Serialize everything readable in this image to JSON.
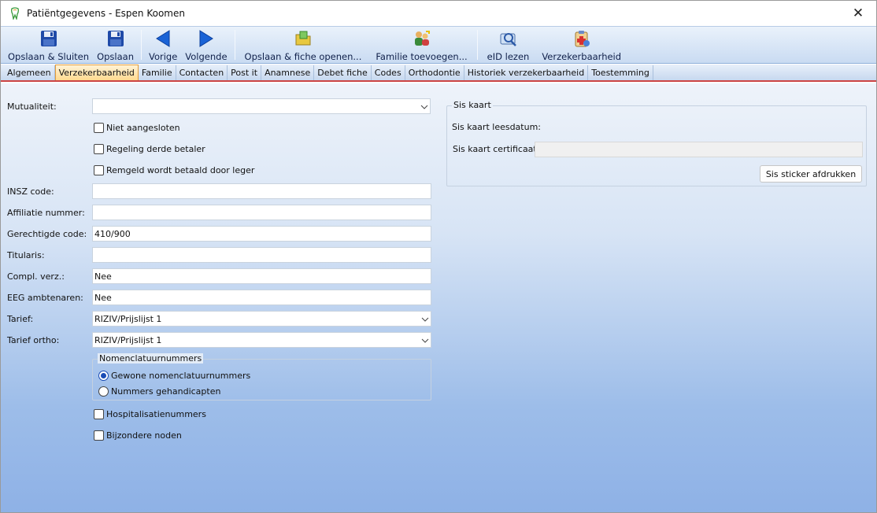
{
  "window": {
    "title": "Patiëntgegevens - Espen Koomen"
  },
  "toolbar": {
    "save_close": "Opslaan & Sluiten",
    "save": "Opslaan",
    "previous": "Vorige",
    "next": "Volgende",
    "save_open_fiche": "Opslaan & fiche openen...",
    "add_family": "Familie toevoegen...",
    "read_eid": "eID lezen",
    "insurability": "Verzekerbaarheid"
  },
  "tabs": [
    "Algemeen",
    "Verzekerbaarheid",
    "Familie",
    "Contacten",
    "Post it",
    "Anamnese",
    "Debet fiche",
    "Codes",
    "Orthodontie",
    "Historiek verzekerbaarheid",
    "Toestemming"
  ],
  "form": {
    "mutualiteit_label": "Mutualiteit:",
    "mutualiteit_value": "",
    "niet_aangesloten": "Niet aangesloten",
    "derde_betaler": "Regeling derde betaler",
    "remgeld_leger": "Remgeld wordt betaald door leger",
    "insz_label": "INSZ code:",
    "insz_value": "",
    "affiliatie_label": "Affiliatie nummer:",
    "affiliatie_value": "",
    "gerechtigde_label": "Gerechtigde code:",
    "gerechtigde_value": "410/900",
    "titularis_label": "Titularis:",
    "titularis_value": "",
    "compl_label": "Compl. verz.:",
    "compl_value": "Nee",
    "eeg_label": "EEG ambtenaren:",
    "eeg_value": "Nee",
    "tarief_label": "Tarief:",
    "tarief_value": "RIZIV/Prijslijst 1",
    "tarief_ortho_label": "Tarief ortho:",
    "tarief_ortho_value": "RIZIV/Prijslijst 1",
    "nomenclatuur_title": "Nomenclatuurnummers",
    "nomenclatuur_gewone": "Gewone nomenclatuurnummers",
    "nomenclatuur_gehandicapten": "Nummers gehandicapten",
    "hospitalisatie": "Hospitalisatienummers",
    "bijzondere": "Bijzondere noden"
  },
  "sis": {
    "title": "Sis kaart",
    "leesdatum_label": "Sis kaart leesdatum:",
    "certificaat_label": "Sis kaart certificaat:",
    "certificaat_value": "",
    "print_button": "Sis sticker afdrukken"
  }
}
